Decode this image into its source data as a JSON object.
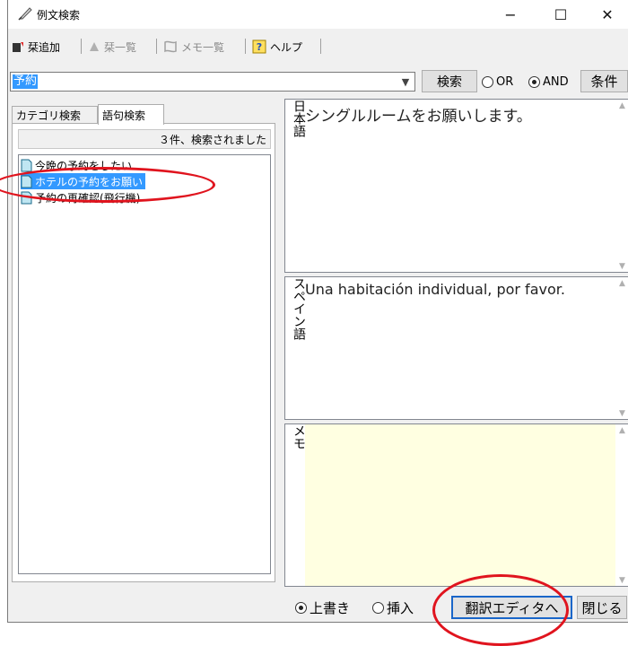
{
  "window": {
    "title": "例文検索",
    "icon": "quill-pen-icon",
    "controls": {
      "minimize": "−",
      "maximize": "☐",
      "close": "✕"
    }
  },
  "toolbar": {
    "items": [
      {
        "label": "栞追加",
        "icon": "bookmark-add-icon",
        "enabled": true
      },
      {
        "label": "栞一覧",
        "icon": "bookmark-list-icon",
        "enabled": false
      },
      {
        "label": "メモ一覧",
        "icon": "memo-list-icon",
        "enabled": false
      },
      {
        "label": "ヘルプ",
        "icon": "help-icon",
        "enabled": true
      }
    ]
  },
  "search": {
    "query": "予約",
    "search_button": "検索",
    "or_label": "OR",
    "and_label": "AND",
    "mode": "AND",
    "conditions_button": "条件"
  },
  "left": {
    "tabs": [
      {
        "label": "カテゴリ検索",
        "active": false
      },
      {
        "label": "語句検索",
        "active": true
      }
    ],
    "result_count": "３件、検索されました",
    "results": [
      {
        "label": "今晩の予約をしたい",
        "selected": false
      },
      {
        "label": "ホテルの予約をお願い",
        "selected": true
      },
      {
        "label": "予約の再確認(飛行機)",
        "selected": false
      }
    ]
  },
  "right": {
    "japanese": {
      "label": "日本語",
      "text": "シングルルームをお願いします。"
    },
    "spanish": {
      "label": "スペイン語",
      "text": "Una habitación individual, por favor."
    },
    "memo": {
      "label": "メモ",
      "text": ""
    }
  },
  "bottom": {
    "overwrite_label": "上書き",
    "insert_label": "挿入",
    "insert_mode": "上書き",
    "translate_editor_button": "翻訳エディタへ",
    "close_button": "閉じる"
  },
  "colors": {
    "selection": "#3399ff",
    "memo_bg": "#ffffe1",
    "highlight_circle": "#e0141e"
  }
}
